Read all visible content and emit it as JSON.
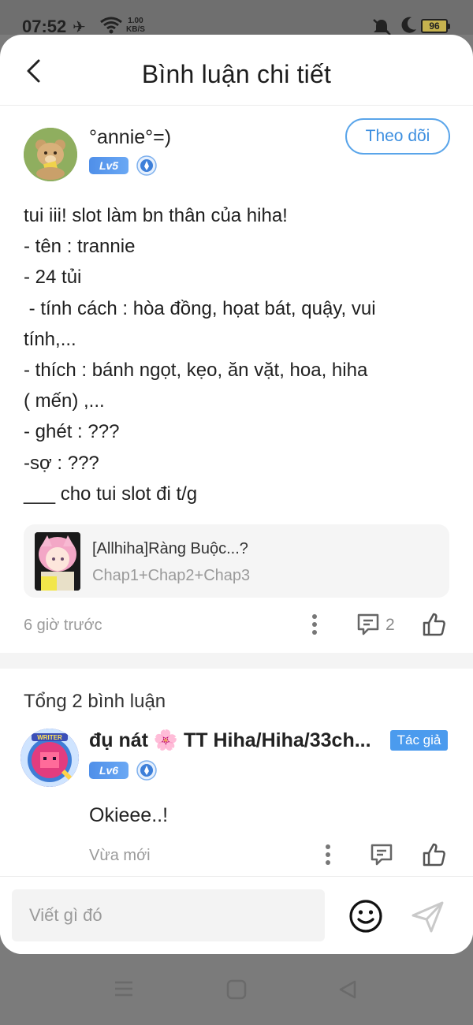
{
  "status": {
    "time": "07:52",
    "speed_top": "1.00",
    "speed_bottom": "KB/S",
    "battery": "96"
  },
  "header": {
    "title": "Bình luận chi tiết"
  },
  "post": {
    "username": "°annie°=)",
    "level": "Lv5",
    "follow_label": "Theo dõi",
    "lines": [
      "tui iii! slot làm bn thân của hiha!",
      "- tên : trannie",
      "- 24 tủi",
      " - tính cách : hòa đồng, họat bát, quậy, vui",
      "tính,...",
      "- thích : bánh ngọt, kẹo, ăn vặt, hoa, hiha",
      "( mến) ,...",
      "- ghét : ???",
      "-sợ : ???",
      "___ cho tui slot đi t/g"
    ],
    "story": {
      "title": "[Allhiha]Ràng Buộc...?",
      "subtitle": "Chap1+Chap2+Chap3"
    },
    "time": "6 giờ trước",
    "reply_count": "2"
  },
  "comments_section": {
    "total_label": "Tổng 2 bình luận",
    "comments": [
      {
        "name": "đụ nát 🌸 TT Hiha/Hiha/33ch...",
        "level": "Lv6",
        "badge": "Tác giả",
        "avatar_text": "WRITER",
        "text": "Okieee..!",
        "time": "Vừa mới"
      }
    ]
  },
  "input": {
    "placeholder": "Viết gì đó"
  },
  "colors": {
    "accent": "#4b9bee",
    "muted_text": "#9a9a9a"
  }
}
